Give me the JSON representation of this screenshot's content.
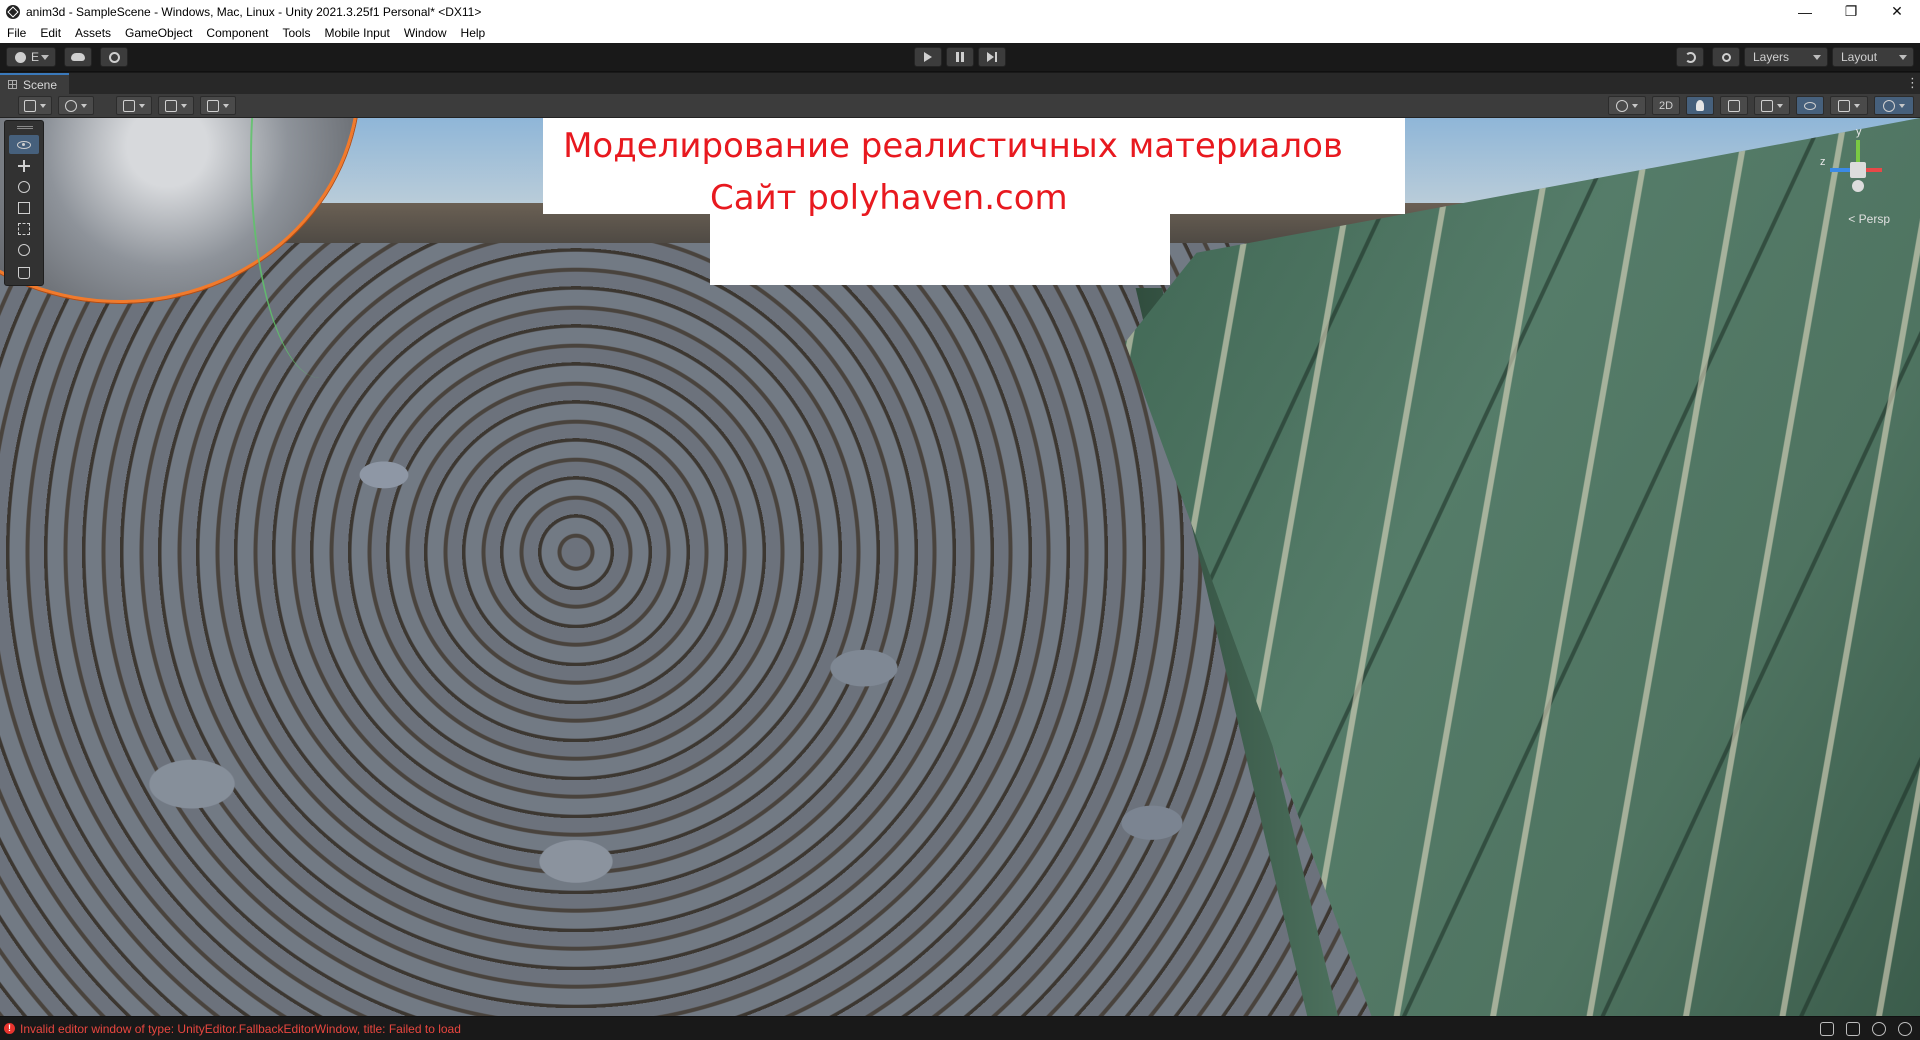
{
  "window": {
    "title": "anim3d - SampleScene - Windows, Mac, Linux - Unity 2021.3.25f1 Personal* <DX11>",
    "minimize_glyph": "—",
    "restore_glyph": "❐",
    "close_glyph": "✕"
  },
  "menu": [
    "File",
    "Edit",
    "Assets",
    "GameObject",
    "Component",
    "Tools",
    "Mobile Input",
    "Window",
    "Help"
  ],
  "main_toolbar": {
    "account_label": "E",
    "layers_label": "Layers",
    "layout_label": "Layout"
  },
  "scene_tab": {
    "label": "Scene"
  },
  "scene_toolbar": {
    "toggle_2d": "2D"
  },
  "caption": {
    "line1": "Моделирование реалистичных материалов",
    "line2": "Сайт polyhaven.com",
    "color": "#e8191f"
  },
  "gizmo": {
    "y": "y",
    "z": "z",
    "projection_label": "< Persp"
  },
  "status": {
    "message": "Invalid editor window of type: UnityEditor.FallbackEditorWindow, title: Failed to load",
    "color": "#e8463f"
  },
  "colors": {
    "selection_accent": "#46607c",
    "sphere_outline": "#f27a2b"
  }
}
